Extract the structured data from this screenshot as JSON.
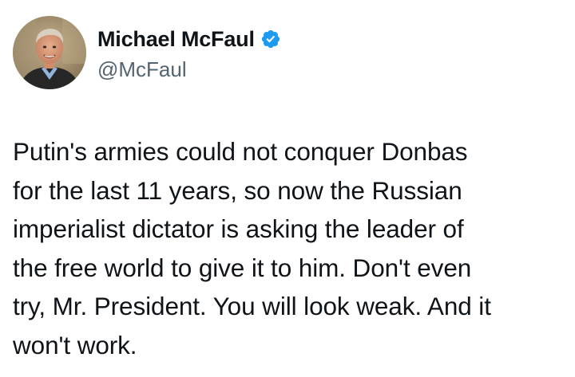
{
  "author": {
    "display_name": "Michael McFaul",
    "handle": "@McFaul",
    "avatar_icon": "profile-photo",
    "verified_icon": "verified-badge-icon",
    "verified_color": "#1d9bf0"
  },
  "tweet": {
    "lines": [
      "Putin's armies could not conquer Donbas",
      "for the last 11 years, so now the Russian",
      "imperialist dictator is asking the leader of",
      "the free world to give it to him.  Don't even",
      "try, Mr. President. You will look weak. And it",
      "won't work."
    ]
  },
  "colors": {
    "text": "#0f1419",
    "secondary_text": "#536471",
    "background": "#ffffff"
  }
}
